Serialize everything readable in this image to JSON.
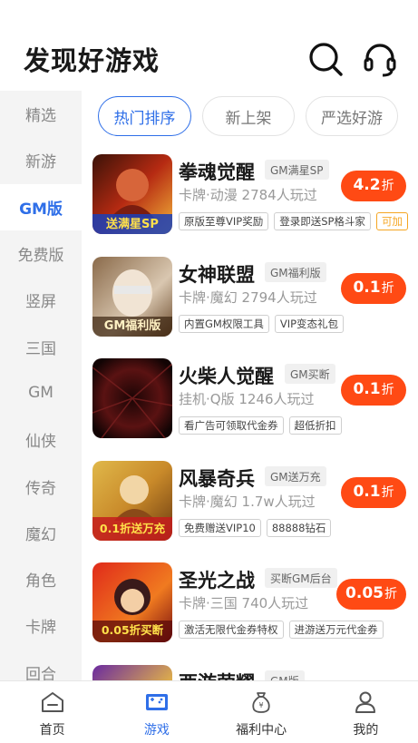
{
  "header": {
    "title": "发现好游戏"
  },
  "sidebar": {
    "items": [
      {
        "label": "精选",
        "active": false
      },
      {
        "label": "新游",
        "active": false
      },
      {
        "label": "GM版",
        "active": true
      },
      {
        "label": "免费版",
        "active": false
      },
      {
        "label": "竖屏",
        "active": false
      },
      {
        "label": "三国",
        "active": false
      },
      {
        "label": "GM",
        "active": false
      },
      {
        "label": "仙侠",
        "active": false
      },
      {
        "label": "传奇",
        "active": false
      },
      {
        "label": "魔幻",
        "active": false
      },
      {
        "label": "角色",
        "active": false
      },
      {
        "label": "卡牌",
        "active": false
      },
      {
        "label": "回合",
        "active": false
      }
    ]
  },
  "tabs": [
    {
      "label": "热门排序",
      "active": true
    },
    {
      "label": "新上架",
      "active": false
    },
    {
      "label": "严选好游",
      "active": false
    }
  ],
  "games": [
    {
      "name": "拳魂觉醒",
      "tag": "GM满星SP",
      "meta": "卡牌·动漫 2784人玩过",
      "badges": [
        "原版至尊VIP奖励",
        "登录即送SP格斗家",
        "可加"
      ],
      "discount": "4.2",
      "unit": "折",
      "thumb_text": "送满星SP"
    },
    {
      "name": "女神联盟",
      "tag": "GM福利版",
      "meta": "卡牌·魔幻 2794人玩过",
      "badges": [
        "内置GM权限工具",
        "VIP变态礼包"
      ],
      "discount": "0.1",
      "unit": "折",
      "thumb_text": "GM福利版"
    },
    {
      "name": "火柴人觉醒",
      "tag": "GM买断",
      "meta": "挂机·Q版 1246人玩过",
      "badges": [
        "看广告可领取代金券",
        "超低折扣"
      ],
      "discount": "0.1",
      "unit": "折",
      "thumb_text": ""
    },
    {
      "name": "风暴奇兵",
      "tag": "GM送万充",
      "meta": "卡牌·魔幻 1.7w人玩过",
      "badges": [
        "免费赠送VIP10",
        "88888钻石"
      ],
      "discount": "0.1",
      "unit": "折",
      "thumb_text": "0.1折送万充"
    },
    {
      "name": "圣光之战",
      "tag": "买断GM后台",
      "meta": "卡牌·三国 740人玩过",
      "badges": [
        "激活无限代金券特权",
        "进游送万元代金券"
      ],
      "discount": "0.05",
      "unit": "折",
      "thumb_text": "0.05折买断"
    },
    {
      "name": "西游荣耀",
      "tag": "GM版",
      "meta": "",
      "badges": [],
      "discount": "",
      "unit": "",
      "thumb_text": ""
    }
  ],
  "nav": [
    {
      "label": "首页",
      "icon": "home-icon",
      "active": false
    },
    {
      "label": "游戏",
      "icon": "gamepad-icon",
      "active": true
    },
    {
      "label": "福利中心",
      "icon": "money-bag-icon",
      "active": false
    },
    {
      "label": "我的",
      "icon": "user-icon",
      "active": false
    }
  ],
  "colors": {
    "accent": "#2f6fe8",
    "discount": "#ff4a14",
    "badge_orange": "#f5a623"
  }
}
